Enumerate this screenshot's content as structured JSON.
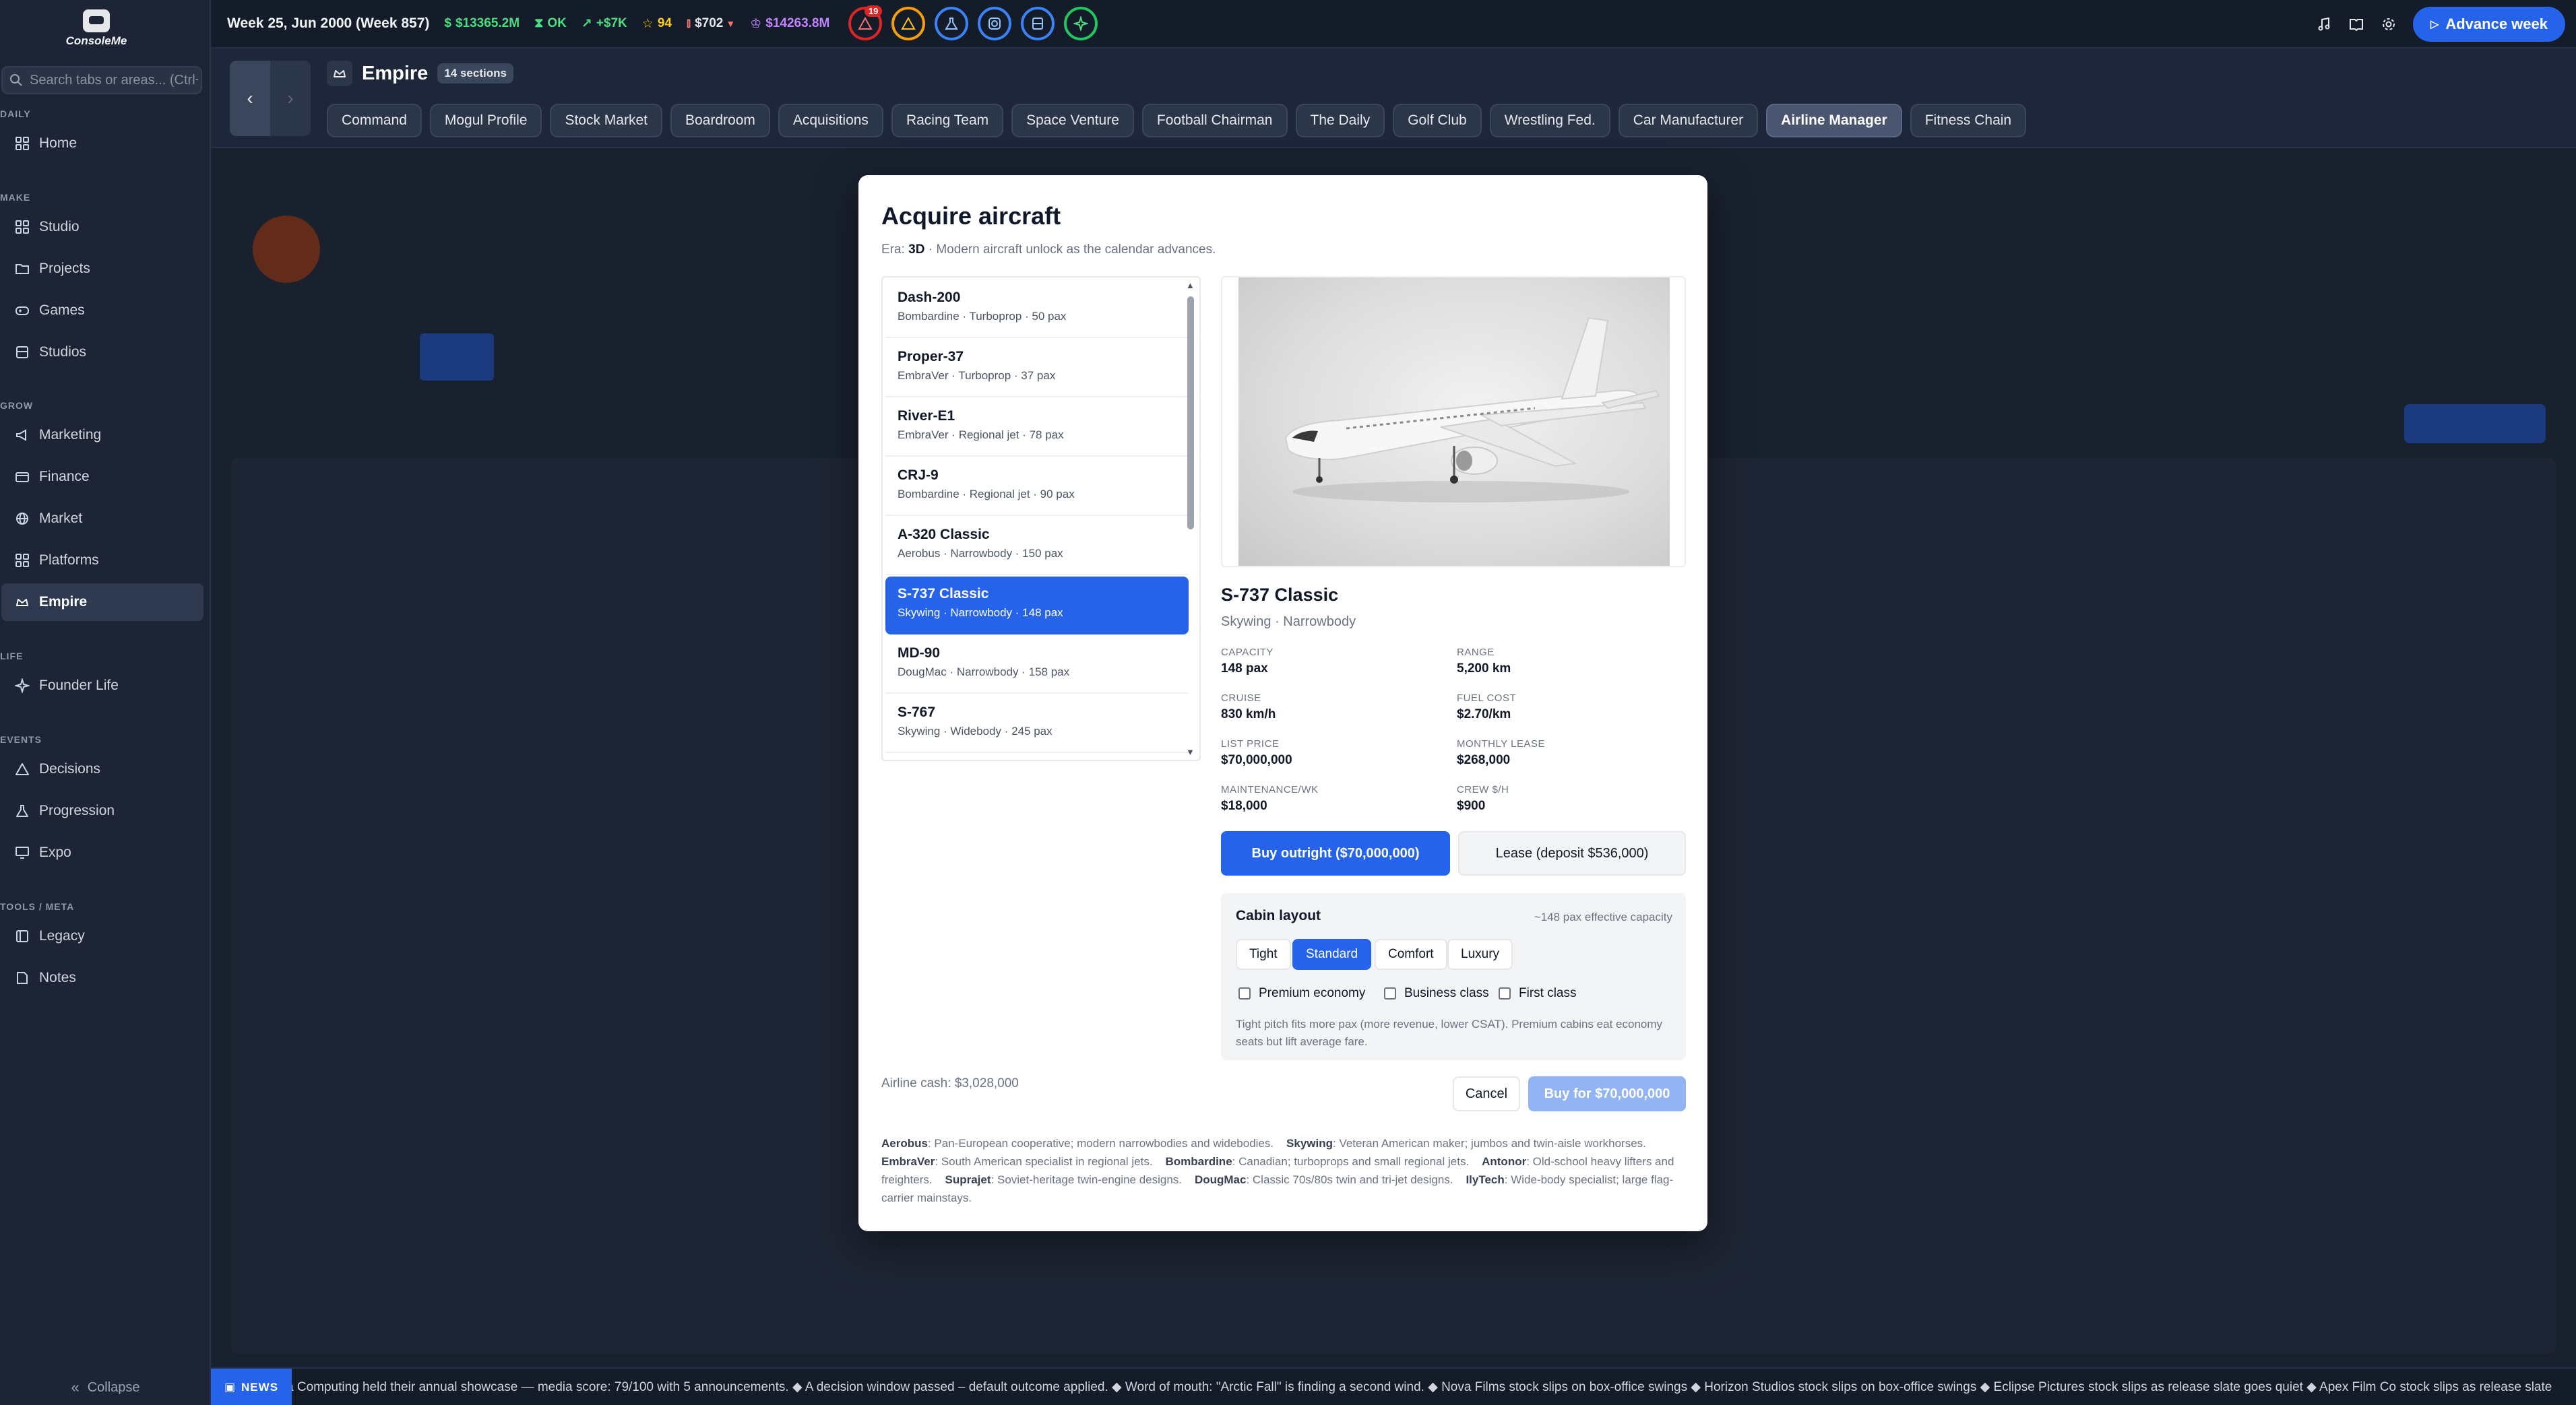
{
  "app": {
    "logo_text": "ConsoleMe"
  },
  "sidebar": {
    "search_placeholder": "Search tabs or areas... (Ctrl+K)",
    "sections": {
      "daily": "DAILY",
      "make": "MAKE",
      "grow": "GROW",
      "life": "LIFE",
      "events": "EVENTS",
      "tools": "TOOLS / META"
    },
    "items": [
      {
        "label": "Home",
        "icon": "grid-icon"
      },
      {
        "label": "Studio",
        "icon": "grid-icon"
      },
      {
        "label": "Projects",
        "icon": "folder-icon"
      },
      {
        "label": "Games",
        "icon": "gamepad-icon"
      },
      {
        "label": "Studios",
        "icon": "building-icon"
      },
      {
        "label": "Marketing",
        "icon": "megaphone-icon"
      },
      {
        "label": "Finance",
        "icon": "wallet-icon"
      },
      {
        "label": "Market",
        "icon": "globe-icon"
      },
      {
        "label": "Platforms",
        "icon": "grid-icon"
      },
      {
        "label": "Empire",
        "icon": "crown-icon",
        "active": true
      },
      {
        "label": "Founder Life",
        "icon": "sparkle-icon"
      },
      {
        "label": "Decisions",
        "icon": "warning-icon"
      },
      {
        "label": "Progression",
        "icon": "flask-icon"
      },
      {
        "label": "Expo",
        "icon": "monitor-icon"
      },
      {
        "label": "Legacy",
        "icon": "book-icon"
      },
      {
        "label": "Notes",
        "icon": "note-icon"
      }
    ],
    "collapse_label": "Collapse"
  },
  "topbar": {
    "date": "Week 25, Jun 2000 (Week 857)",
    "stats": {
      "cash": "$13365.2M",
      "status": "OK",
      "trend": "+$7K",
      "rating": "94",
      "price": "$702",
      "valuation": "$14263.8M"
    },
    "alert_count": "19",
    "advance_label": "Advance week",
    "colors": {
      "cash": "#4ade80",
      "status": "#4ade80",
      "trend": "#4ade80",
      "rating": "#facc15",
      "price": "#e5e7eb",
      "valuation": "#c084fc"
    }
  },
  "section": {
    "title": "Empire",
    "count": "14 sections",
    "tabs": [
      "Command",
      "Mogul Profile",
      "Stock Market",
      "Boardroom",
      "Acquisitions",
      "Racing Team",
      "Space Venture",
      "Football Chairman",
      "The Daily",
      "Golf Club",
      "Wrestling Fed.",
      "Car Manufacturer",
      "Airline Manager",
      "Fitness Chain"
    ],
    "active_tab": "Airline Manager"
  },
  "modal": {
    "title": "Acquire aircraft",
    "era_prefix": "Era:",
    "era_value": "3D",
    "era_note": "· Modern aircraft unlock as the calendar advances.",
    "aircraft": [
      {
        "name": "Dash-200",
        "detail": "Bombardine · Turboprop · 50 pax"
      },
      {
        "name": "Proper-37",
        "detail": "EmbraVer · Turboprop · 37 pax"
      },
      {
        "name": "River-E1",
        "detail": "EmbraVer · Regional jet · 78 pax"
      },
      {
        "name": "CRJ-9",
        "detail": "Bombardine · Regional jet · 90 pax"
      },
      {
        "name": "A-320 Classic",
        "detail": "Aerobus · Narrowbody · 150 pax"
      },
      {
        "name": "S-737 Classic",
        "detail": "Skywing · Narrowbody · 148 pax",
        "selected": true
      },
      {
        "name": "MD-90",
        "detail": "DougMac · Narrowbody · 158 pax"
      },
      {
        "name": "S-767",
        "detail": "Skywing · Widebody · 245 pax"
      }
    ],
    "selected": {
      "name": "S-737 Classic",
      "maker": "Skywing · Narrowbody",
      "specs": [
        {
          "label": "CAPACITY",
          "value": "148 pax"
        },
        {
          "label": "RANGE",
          "value": "5,200 km"
        },
        {
          "label": "CRUISE",
          "value": "830 km/h"
        },
        {
          "label": "FUEL COST",
          "value": "$2.70/km"
        },
        {
          "label": "LIST PRICE",
          "value": "$70,000,000"
        },
        {
          "label": "MONTHLY LEASE",
          "value": "$268,000"
        },
        {
          "label": "MAINTENANCE/WK",
          "value": "$18,000"
        },
        {
          "label": "CREW $/H",
          "value": "$900"
        }
      ]
    },
    "buy_outright_label": "Buy outright ($70,000,000)",
    "lease_label": "Lease (deposit $536,000)",
    "cabin": {
      "title": "Cabin layout",
      "effective": "~148 pax effective capacity",
      "layouts": [
        "Tight",
        "Standard",
        "Comfort",
        "Luxury"
      ],
      "active_layout": "Standard",
      "options": [
        {
          "label": "Premium economy",
          "checked": false
        },
        {
          "label": "Business class",
          "checked": false
        },
        {
          "label": "First class",
          "checked": false
        }
      ],
      "hint": "Tight pitch fits more pax (more revenue, lower CSAT). Premium cabins eat economy seats but lift average fare."
    },
    "airline_cash": "Airline cash: $3,028,000",
    "cancel_label": "Cancel",
    "confirm_label": "Buy for $70,000,000",
    "makers": [
      {
        "name": "Aerobus",
        "desc": ": Pan-European cooperative; modern narrowbodies and widebodies."
      },
      {
        "name": "Skywing",
        "desc": ": Veteran American maker; jumbos and twin-aisle workhorses."
      },
      {
        "name": "EmbraVer",
        "desc": ": South American specialist in regional jets."
      },
      {
        "name": "Bombardine",
        "desc": ": Canadian; turboprops and small regional jets."
      },
      {
        "name": "Antonor",
        "desc": ": Old-school heavy lifters and freighters."
      },
      {
        "name": "Suprajet",
        "desc": ": Soviet-heritage twin-engine designs."
      },
      {
        "name": "DougMac",
        "desc": ": Classic 70s/80s twin and tri-jet designs."
      },
      {
        "name": "IlyTech",
        "desc": ": Wide-body specialist; large flag-carrier mainstays."
      }
    ]
  },
  "ticker": {
    "badge": "NEWS",
    "text": "a Computing held their annual showcase — media score: 79/100 with 5 announcements. ◆ A decision window passed – default outcome applied. ◆ Word of mouth: \"Arctic Fall\" is finding a second wind. ◆ Nova Films stock slips on box-office swings ◆ Horizon Studios stock slips on box-office swings ◆ Eclipse Pictures stock slips as release slate goes quiet ◆ Apex Film Co stock slips as release slate"
  }
}
